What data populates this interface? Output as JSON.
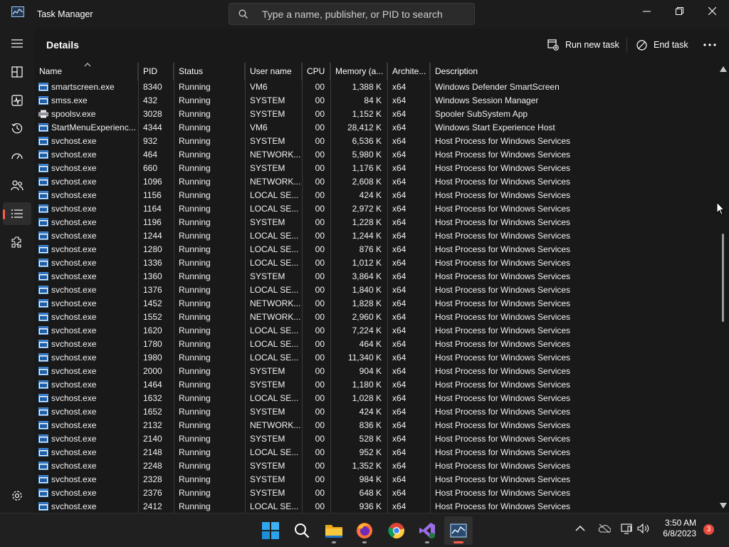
{
  "window": {
    "title": "Task Manager",
    "search_placeholder": "Type a name, publisher, or PID to search"
  },
  "nav": [
    {
      "name": "hamburger-menu",
      "icon": "hamburger-icon"
    },
    {
      "name": "processes",
      "icon": "processes-icon"
    },
    {
      "name": "performance",
      "icon": "performance-icon"
    },
    {
      "name": "app-history",
      "icon": "history-icon"
    },
    {
      "name": "startup-apps",
      "icon": "startup-icon"
    },
    {
      "name": "users",
      "icon": "users-icon"
    },
    {
      "name": "details",
      "icon": "details-icon",
      "active": true
    },
    {
      "name": "services",
      "icon": "services-icon"
    },
    {
      "name": "settings",
      "icon": "settings-icon"
    }
  ],
  "page": {
    "title": "Details",
    "run_new_task": "Run new task",
    "end_task": "End task"
  },
  "columns": [
    "Name",
    "PID",
    "Status",
    "User name",
    "CPU",
    "Memory (a...",
    "Archite...",
    "Description"
  ],
  "rows": [
    {
      "name": "smartscreen.exe",
      "pid": "8340",
      "status": "Running",
      "user": "VM6",
      "cpu": "00",
      "memory": "1,388 K",
      "arch": "x64",
      "desc": "Windows Defender SmartScreen",
      "icon": "window"
    },
    {
      "name": "smss.exe",
      "pid": "432",
      "status": "Running",
      "user": "SYSTEM",
      "cpu": "00",
      "memory": "84 K",
      "arch": "x64",
      "desc": "Windows Session Manager",
      "icon": "window"
    },
    {
      "name": "spoolsv.exe",
      "pid": "3028",
      "status": "Running",
      "user": "SYSTEM",
      "cpu": "00",
      "memory": "1,152 K",
      "arch": "x64",
      "desc": "Spooler SubSystem App",
      "icon": "printer"
    },
    {
      "name": "StartMenuExperienc...",
      "pid": "4344",
      "status": "Running",
      "user": "VM6",
      "cpu": "00",
      "memory": "28,412 K",
      "arch": "x64",
      "desc": "Windows Start Experience Host",
      "icon": "window"
    },
    {
      "name": "svchost.exe",
      "pid": "932",
      "status": "Running",
      "user": "SYSTEM",
      "cpu": "00",
      "memory": "6,536 K",
      "arch": "x64",
      "desc": "Host Process for Windows Services",
      "icon": "window"
    },
    {
      "name": "svchost.exe",
      "pid": "464",
      "status": "Running",
      "user": "NETWORK...",
      "cpu": "00",
      "memory": "5,980 K",
      "arch": "x64",
      "desc": "Host Process for Windows Services",
      "icon": "window"
    },
    {
      "name": "svchost.exe",
      "pid": "660",
      "status": "Running",
      "user": "SYSTEM",
      "cpu": "00",
      "memory": "1,176 K",
      "arch": "x64",
      "desc": "Host Process for Windows Services",
      "icon": "window"
    },
    {
      "name": "svchost.exe",
      "pid": "1096",
      "status": "Running",
      "user": "NETWORK...",
      "cpu": "00",
      "memory": "2,608 K",
      "arch": "x64",
      "desc": "Host Process for Windows Services",
      "icon": "window"
    },
    {
      "name": "svchost.exe",
      "pid": "1156",
      "status": "Running",
      "user": "LOCAL SE...",
      "cpu": "00",
      "memory": "424 K",
      "arch": "x64",
      "desc": "Host Process for Windows Services",
      "icon": "window"
    },
    {
      "name": "svchost.exe",
      "pid": "1164",
      "status": "Running",
      "user": "LOCAL SE...",
      "cpu": "00",
      "memory": "2,972 K",
      "arch": "x64",
      "desc": "Host Process for Windows Services",
      "icon": "window"
    },
    {
      "name": "svchost.exe",
      "pid": "1196",
      "status": "Running",
      "user": "SYSTEM",
      "cpu": "00",
      "memory": "1,228 K",
      "arch": "x64",
      "desc": "Host Process for Windows Services",
      "icon": "window"
    },
    {
      "name": "svchost.exe",
      "pid": "1244",
      "status": "Running",
      "user": "LOCAL SE...",
      "cpu": "00",
      "memory": "1,244 K",
      "arch": "x64",
      "desc": "Host Process for Windows Services",
      "icon": "window"
    },
    {
      "name": "svchost.exe",
      "pid": "1280",
      "status": "Running",
      "user": "LOCAL SE...",
      "cpu": "00",
      "memory": "876 K",
      "arch": "x64",
      "desc": "Host Process for Windows Services",
      "icon": "window"
    },
    {
      "name": "svchost.exe",
      "pid": "1336",
      "status": "Running",
      "user": "LOCAL SE...",
      "cpu": "00",
      "memory": "1,012 K",
      "arch": "x64",
      "desc": "Host Process for Windows Services",
      "icon": "window"
    },
    {
      "name": "svchost.exe",
      "pid": "1360",
      "status": "Running",
      "user": "SYSTEM",
      "cpu": "00",
      "memory": "3,864 K",
      "arch": "x64",
      "desc": "Host Process for Windows Services",
      "icon": "window"
    },
    {
      "name": "svchost.exe",
      "pid": "1376",
      "status": "Running",
      "user": "LOCAL SE...",
      "cpu": "00",
      "memory": "1,840 K",
      "arch": "x64",
      "desc": "Host Process for Windows Services",
      "icon": "window"
    },
    {
      "name": "svchost.exe",
      "pid": "1452",
      "status": "Running",
      "user": "NETWORK...",
      "cpu": "00",
      "memory": "1,828 K",
      "arch": "x64",
      "desc": "Host Process for Windows Services",
      "icon": "window"
    },
    {
      "name": "svchost.exe",
      "pid": "1552",
      "status": "Running",
      "user": "NETWORK...",
      "cpu": "00",
      "memory": "2,960 K",
      "arch": "x64",
      "desc": "Host Process for Windows Services",
      "icon": "window"
    },
    {
      "name": "svchost.exe",
      "pid": "1620",
      "status": "Running",
      "user": "LOCAL SE...",
      "cpu": "00",
      "memory": "7,224 K",
      "arch": "x64",
      "desc": "Host Process for Windows Services",
      "icon": "window"
    },
    {
      "name": "svchost.exe",
      "pid": "1780",
      "status": "Running",
      "user": "LOCAL SE...",
      "cpu": "00",
      "memory": "464 K",
      "arch": "x64",
      "desc": "Host Process for Windows Services",
      "icon": "window"
    },
    {
      "name": "svchost.exe",
      "pid": "1980",
      "status": "Running",
      "user": "LOCAL SE...",
      "cpu": "00",
      "memory": "11,340 K",
      "arch": "x64",
      "desc": "Host Process for Windows Services",
      "icon": "window"
    },
    {
      "name": "svchost.exe",
      "pid": "2000",
      "status": "Running",
      "user": "SYSTEM",
      "cpu": "00",
      "memory": "904 K",
      "arch": "x64",
      "desc": "Host Process for Windows Services",
      "icon": "window"
    },
    {
      "name": "svchost.exe",
      "pid": "1464",
      "status": "Running",
      "user": "SYSTEM",
      "cpu": "00",
      "memory": "1,180 K",
      "arch": "x64",
      "desc": "Host Process for Windows Services",
      "icon": "window"
    },
    {
      "name": "svchost.exe",
      "pid": "1632",
      "status": "Running",
      "user": "LOCAL SE...",
      "cpu": "00",
      "memory": "1,028 K",
      "arch": "x64",
      "desc": "Host Process for Windows Services",
      "icon": "window"
    },
    {
      "name": "svchost.exe",
      "pid": "1652",
      "status": "Running",
      "user": "SYSTEM",
      "cpu": "00",
      "memory": "424 K",
      "arch": "x64",
      "desc": "Host Process for Windows Services",
      "icon": "window"
    },
    {
      "name": "svchost.exe",
      "pid": "2132",
      "status": "Running",
      "user": "NETWORK...",
      "cpu": "00",
      "memory": "836 K",
      "arch": "x64",
      "desc": "Host Process for Windows Services",
      "icon": "window"
    },
    {
      "name": "svchost.exe",
      "pid": "2140",
      "status": "Running",
      "user": "SYSTEM",
      "cpu": "00",
      "memory": "528 K",
      "arch": "x64",
      "desc": "Host Process for Windows Services",
      "icon": "window"
    },
    {
      "name": "svchost.exe",
      "pid": "2148",
      "status": "Running",
      "user": "LOCAL SE...",
      "cpu": "00",
      "memory": "952 K",
      "arch": "x64",
      "desc": "Host Process for Windows Services",
      "icon": "window"
    },
    {
      "name": "svchost.exe",
      "pid": "2248",
      "status": "Running",
      "user": "SYSTEM",
      "cpu": "00",
      "memory": "1,352 K",
      "arch": "x64",
      "desc": "Host Process for Windows Services",
      "icon": "window"
    },
    {
      "name": "svchost.exe",
      "pid": "2328",
      "status": "Running",
      "user": "SYSTEM",
      "cpu": "00",
      "memory": "984 K",
      "arch": "x64",
      "desc": "Host Process for Windows Services",
      "icon": "window"
    },
    {
      "name": "svchost.exe",
      "pid": "2376",
      "status": "Running",
      "user": "SYSTEM",
      "cpu": "00",
      "memory": "648 K",
      "arch": "x64",
      "desc": "Host Process for Windows Services",
      "icon": "window"
    },
    {
      "name": "svchost.exe",
      "pid": "2412",
      "status": "Running",
      "user": "LOCAL SE...",
      "cpu": "00",
      "memory": "936 K",
      "arch": "x64",
      "desc": "Host Process for Windows Services",
      "icon": "window"
    }
  ],
  "taskbar": {
    "apps": [
      {
        "name": "start",
        "icon": "windows-logo-icon"
      },
      {
        "name": "search",
        "icon": "search-icon"
      },
      {
        "name": "file-explorer",
        "icon": "folder-icon"
      },
      {
        "name": "firefox",
        "icon": "firefox-icon"
      },
      {
        "name": "chrome",
        "icon": "chrome-icon"
      },
      {
        "name": "visual-studio",
        "icon": "visual-studio-icon"
      },
      {
        "name": "task-manager",
        "icon": "task-manager-icon",
        "active": true
      }
    ],
    "time": "3:50 AM",
    "date": "6/8/2023",
    "notification_count": "3"
  },
  "colors": {
    "background": "#191919",
    "accent": "#ff5b4b",
    "text": "#ffffff"
  }
}
